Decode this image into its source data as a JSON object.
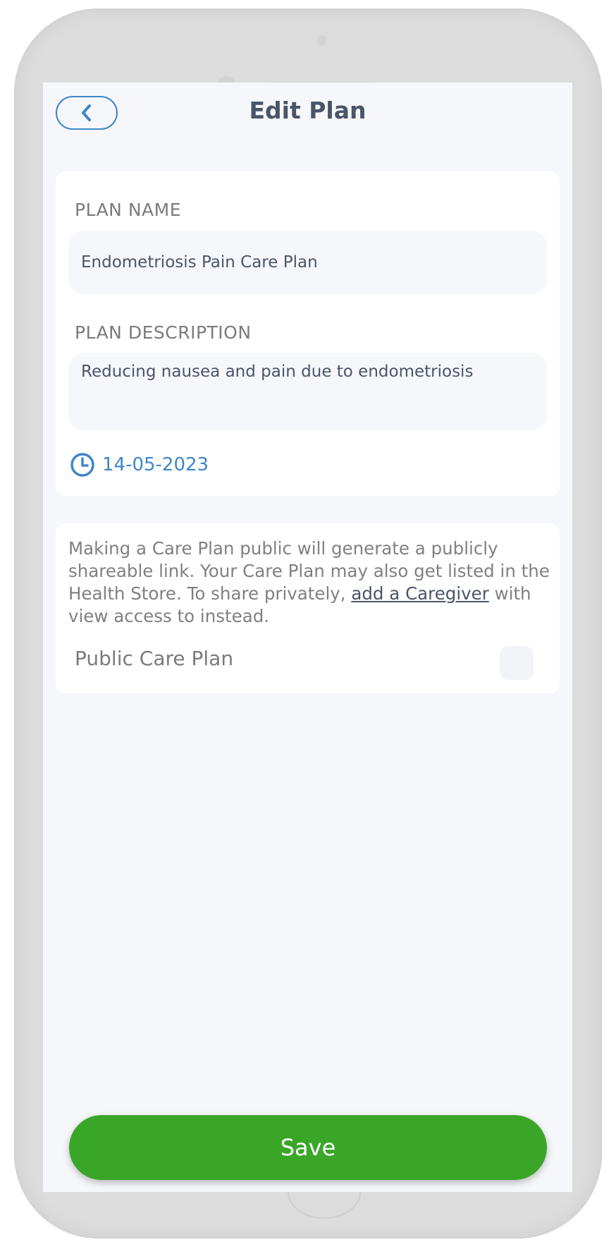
{
  "header": {
    "title": "Edit Plan",
    "back_icon": "chevron-left-icon"
  },
  "plan_card": {
    "name_label": "PLAN NAME",
    "name_value": "Endometriosis Pain Care Plan",
    "description_label": "PLAN DESCRIPTION",
    "description_value": "Reducing nausea and pain due to endometriosis",
    "date_icon": "clock-icon",
    "date": "14-05-2023"
  },
  "public_card": {
    "info_text_before": "Making a Care Plan public will generate a publicly shareable link. Your Care Plan may also get listed in the Health Store. To share privately, ",
    "info_link": "add a Caregiver",
    "info_text_after": " with view access to  instead.",
    "toggle_label": "Public Care Plan",
    "toggle_checked": false
  },
  "footer": {
    "save_label": "Save"
  },
  "colors": {
    "accent": "#3f86c8",
    "save_green": "#3aa628",
    "screen_bg": "#f6f7fb",
    "title_text": "#4a5568"
  }
}
